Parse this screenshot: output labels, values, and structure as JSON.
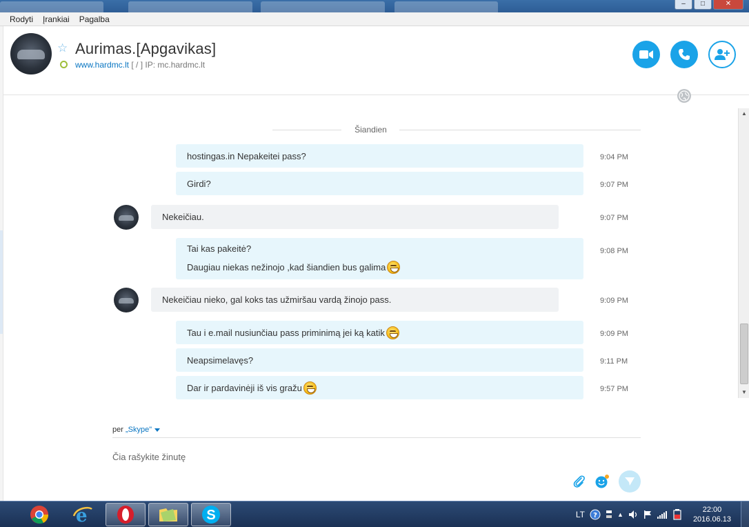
{
  "menu": {
    "items": [
      "Rodyti",
      "Įrankiai",
      "Pagalba"
    ]
  },
  "window_controls": {
    "minimize": "–",
    "maximize": "□",
    "close": "✕"
  },
  "contact": {
    "name": "Aurimas.[Apgavikas]",
    "mood_link": "www.hardmc.lt",
    "mood_rest": " [ / ] IP: mc.hardmc.lt",
    "status_color": "#9fbe3a"
  },
  "header_buttons": {
    "video": "video-call",
    "call": "audio-call",
    "add": "add-people"
  },
  "conversation": {
    "day_separator": "Šiandien",
    "messages": [
      {
        "dir": "out",
        "lines": [
          "hostingas.in Nepakeitei pass?"
        ],
        "time": "9:04 PM"
      },
      {
        "dir": "out",
        "lines": [
          "Girdi?"
        ],
        "time": "9:07 PM"
      },
      {
        "dir": "in",
        "lines": [
          "Nekeičiau."
        ],
        "time": "9:07 PM"
      },
      {
        "dir": "out",
        "lines": [
          "Tai kas pakeitė?",
          "Daugiau niekas nežinojo ,kad šiandien bus galima"
        ],
        "time": "9:08 PM",
        "emoji_on_last": true
      },
      {
        "dir": "in",
        "lines": [
          "Nekeičiau nieko, gal koks tas užmiršau vardą žinojo pass."
        ],
        "time": "9:09 PM"
      },
      {
        "dir": "out",
        "lines": [
          "Tau i e.mail nusiunčiau pass priminimą jei ką katik"
        ],
        "time": "9:09 PM",
        "emoji_on_last": true
      },
      {
        "dir": "out",
        "lines": [
          "Neapsimelavęs?"
        ],
        "time": "9:11 PM"
      },
      {
        "dir": "out",
        "lines": [
          "Dar ir pardavinėji iš vis gražu"
        ],
        "time": "9:57 PM",
        "emoji_on_last": true
      }
    ]
  },
  "composer": {
    "via_prefix": "per",
    "via_service": "„Skype\"",
    "placeholder": "Čia rašykite žinutę"
  },
  "taskbar": {
    "apps": [
      "chrome",
      "internet-explorer",
      "opera",
      "file-explorer",
      "skype"
    ],
    "language": "LT",
    "time": "22:00",
    "date": "2016.06.13"
  },
  "colors": {
    "accent": "#1aa3e8",
    "bubble_out": "#e7f6fc",
    "bubble_in": "#f0f2f4"
  }
}
